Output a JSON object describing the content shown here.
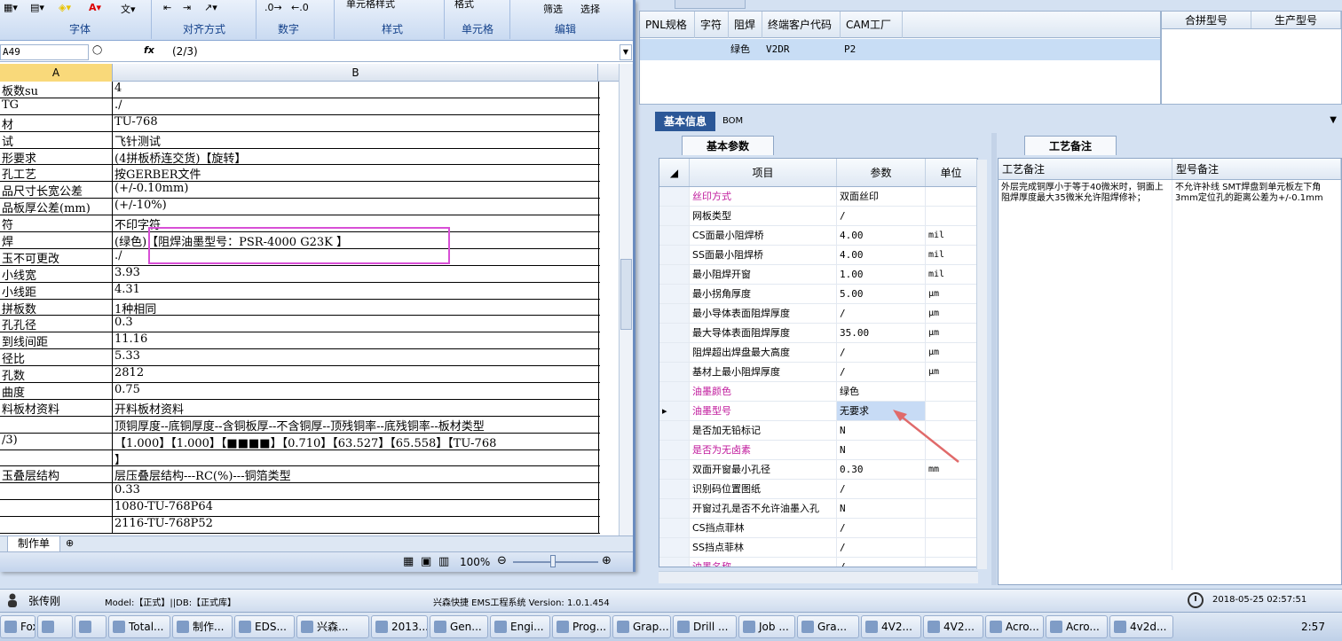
{
  "ems": {
    "top_grid_columns": [
      "PNL规格",
      "字符",
      "阻焊",
      "终端客户代码",
      "CAM工厂"
    ],
    "top_grid_row": [
      "绿色",
      "V2DR",
      "P2"
    ],
    "right_grid_columns": [
      "合拼型号",
      "生产型号"
    ],
    "tabs": {
      "basic": "基本信息",
      "bom": "BOM"
    },
    "params_tab": "基本参数",
    "notes_tab": "工艺备注",
    "params_columns": {
      "item": "项目",
      "param": "参数",
      "unit": "单位"
    },
    "params_rows": [
      {
        "item": "丝印方式",
        "param": "双面丝印",
        "unit": ""
      },
      {
        "item": "网板类型",
        "param": "/",
        "unit": ""
      },
      {
        "item": "CS面最小阻焊桥",
        "param": "4.00",
        "unit": "mil"
      },
      {
        "item": "SS面最小阻焊桥",
        "param": "4.00",
        "unit": "mil"
      },
      {
        "item": "最小阻焊开窗",
        "param": "1.00",
        "unit": "mil"
      },
      {
        "item": "最小拐角厚度",
        "param": "5.00",
        "unit": "μm"
      },
      {
        "item": "最小导体表面阻焊厚度",
        "param": "/",
        "unit": "μm"
      },
      {
        "item": "最大导体表面阻焊厚度",
        "param": "35.00",
        "unit": "μm"
      },
      {
        "item": "阻焊超出焊盘最大高度",
        "param": "/",
        "unit": "μm"
      },
      {
        "item": "基材上最小阻焊厚度",
        "param": "/",
        "unit": "μm"
      },
      {
        "item": "油墨颜色",
        "param": "绿色",
        "unit": ""
      },
      {
        "item": "油墨型号",
        "param": "无要求",
        "unit": ""
      },
      {
        "item": "是否加无铅标记",
        "param": "N",
        "unit": ""
      },
      {
        "item": "是否为无卤素",
        "param": "N",
        "unit": ""
      },
      {
        "item": "双面开窗最小孔径",
        "param": "0.30",
        "unit": "mm"
      },
      {
        "item": "识别码位置图纸",
        "param": "/",
        "unit": ""
      },
      {
        "item": "开窗过孔是否不允许油墨入孔",
        "param": "N",
        "unit": ""
      },
      {
        "item": "CS挡点菲林",
        "param": "/",
        "unit": ""
      },
      {
        "item": "SS挡点菲林",
        "param": "/",
        "unit": ""
      },
      {
        "item": "油墨名称",
        "param": "/",
        "unit": ""
      }
    ],
    "notes_columns": {
      "process": "工艺备注",
      "model": "型号备注"
    },
    "notes_process": "外层完成铜厚小于等于40微米时，铜面上阻焊厚度最大35微米允许阻焊修补；",
    "notes_model": "不允许补线 SMT焊盘到单元板左下角3mm定位孔的距离公差为+/-0.1mm",
    "status": {
      "user": "张传刚",
      "model": "Model:【正式】||DB:【正式库】",
      "system": "兴森快捷 EMS工程系统 Version: 1.0.1.454",
      "datetime": "2018-05-25 02:57:51"
    }
  },
  "excel": {
    "ribbon_groups": [
      "字体",
      "对齐方式",
      "数字",
      "样式",
      "单元格",
      "编辑"
    ],
    "ribbon_buttons": {
      "cell_style": "单元格样式",
      "format": "格式",
      "filter": "筛选",
      "select": "选择"
    },
    "namebox": "A49",
    "fx": "fx",
    "formula": "(2/3)",
    "columns": [
      "A",
      "B"
    ],
    "rows": [
      {
        "a": "板数su",
        "b": "4"
      },
      {
        "a": "TG",
        "b": "./"
      },
      {
        "a": "材",
        "b": "TU-768"
      },
      {
        "a": "试",
        "b": "飞针测试"
      },
      {
        "a": "形要求",
        "b": "(4拼板桥连交货)【旋转】"
      },
      {
        "a": "孔工艺",
        "b": "按GERBER文件"
      },
      {
        "a": "品尺寸长宽公差",
        "b": "(+/-0.10mm)"
      },
      {
        "a": "品板厚公差(mm)",
        "b": "(+/-10%)"
      },
      {
        "a": "符",
        "b": "不印字符"
      },
      {
        "a": "焊",
        "b": "(绿色)【阻焊油墨型号：PSR-4000 G23K 】"
      },
      {
        "a": "玉不可更改",
        "b": "./"
      },
      {
        "a": "小线宽",
        "b": "3.93"
      },
      {
        "a": "小线距",
        "b": "4.31"
      },
      {
        "a": "拼板数",
        "b": "1种相同"
      },
      {
        "a": "孔孔径",
        "b": "0.3"
      },
      {
        "a": "到线间距",
        "b": "11.16"
      },
      {
        "a": "径比",
        "b": "5.33"
      },
      {
        "a": "孔数",
        "b": "2812"
      },
      {
        "a": "曲度",
        "b": "0.75"
      },
      {
        "a": "料板材资料",
        "b": "开料板材资料"
      },
      {
        "a": "",
        "b": "顶铜厚度--底铜厚度--含铜板厚--不含铜厚--顶残铜率--底残铜率--板材类型"
      },
      {
        "a": "/3)",
        "b": "【1.000】【1.000】【■■■■】【0.710】【63.527】【65.558】【TU-768"
      },
      {
        "a": "",
        "b": "】"
      },
      {
        "a": "玉叠层结构",
        "b": "层压叠层结构---RC(%)---铜箔类型"
      },
      {
        "a": "",
        "b": "0.33"
      },
      {
        "a": "",
        "b": "1080-TU-768P64"
      },
      {
        "a": "",
        "b": "2116-TU-768P52"
      }
    ],
    "sheet_tab": "制作单",
    "zoom": "100%"
  },
  "taskbar": {
    "items": [
      "Fox...",
      "",
      "",
      "Total...",
      "制作...",
      "EDS...",
      "兴森...",
      "2013...",
      "Gen...",
      "Engi...",
      "Prog...",
      "Grap...",
      "Drill ...",
      "Job ...",
      "Gra...",
      "4V2...",
      "4V2...",
      "Acro...",
      "Acro...",
      "4v2d..."
    ],
    "time": "2:57"
  }
}
